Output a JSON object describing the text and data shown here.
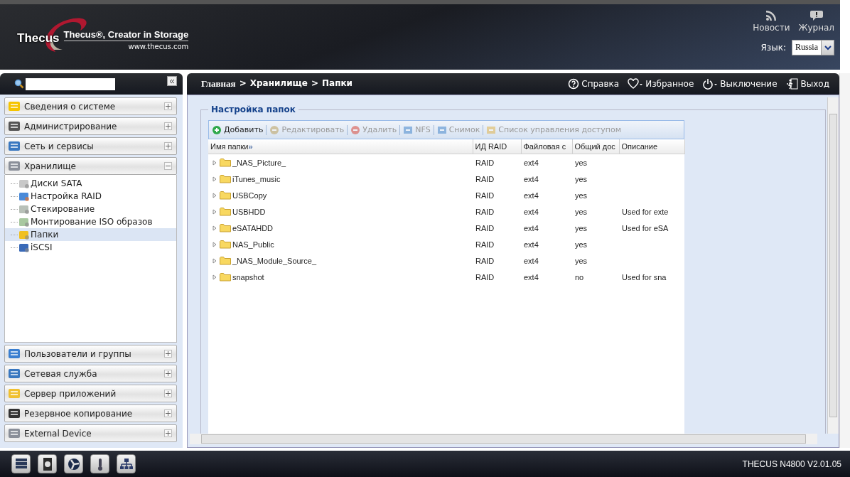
{
  "header": {
    "logo": "Thecus",
    "slogan": "Thecus®, Creator in Storage",
    "url": "www.thecus.com",
    "links": [
      {
        "label": "Новости"
      },
      {
        "label": "Журнал"
      }
    ],
    "language": {
      "label": "Язык:",
      "value": "Russia"
    }
  },
  "sidebar": {
    "sections": [
      {
        "label": "Сведения о системе",
        "expanded": false
      },
      {
        "label": "Администрирование",
        "expanded": false
      },
      {
        "label": "Сеть и сервисы",
        "expanded": false
      },
      {
        "label": "Хранилище",
        "expanded": true,
        "children": [
          {
            "label": "Диски SATA",
            "selected": false
          },
          {
            "label": "Настройка RAID",
            "selected": false
          },
          {
            "label": "Стекирование",
            "selected": false
          },
          {
            "label": "Монтирование ISO образов",
            "selected": false
          },
          {
            "label": "Папки",
            "selected": true
          },
          {
            "label": "iSCSI",
            "selected": false
          }
        ]
      },
      {
        "label": "Пользователи и группы",
        "expanded": false
      },
      {
        "label": "Сетевая служба",
        "expanded": false
      },
      {
        "label": "Сервер приложений",
        "expanded": false
      },
      {
        "label": "Резервное копирование",
        "expanded": false
      },
      {
        "label": "External Device",
        "expanded": false
      }
    ]
  },
  "breadcrumb": {
    "items": [
      "Главная",
      "Хранилище",
      "Папки"
    ],
    "separator": ">"
  },
  "nav": [
    {
      "label": "Справка",
      "kind": "help"
    },
    {
      "label": "Избранное",
      "kind": "favorite"
    },
    {
      "label": "Выключение",
      "kind": "power"
    },
    {
      "label": "Выход",
      "kind": "exit"
    }
  ],
  "panel": {
    "title": "Настройка папок",
    "toolbar": [
      {
        "label": "Добавить",
        "disabled": false
      },
      {
        "label": "Редактировать",
        "disabled": true
      },
      {
        "label": "Удалить",
        "disabled": true
      },
      {
        "label": "NFS",
        "disabled": true
      },
      {
        "label": "Снимок",
        "disabled": true
      },
      {
        "label": "Список управления доступом",
        "disabled": true
      }
    ],
    "columns": [
      "Имя папки",
      "ИД RAID",
      "Файловая с",
      "Общий дос",
      "Описание"
    ],
    "sort_mark": "»",
    "rows": [
      {
        "name": "_NAS_Picture_",
        "raid": "RAID",
        "fs": "ext4",
        "shared": "yes"
      },
      {
        "name": "iTunes_music",
        "raid": "RAID",
        "fs": "ext4",
        "shared": "yes"
      },
      {
        "name": "USBCopy",
        "raid": "RAID",
        "fs": "ext4",
        "shared": "yes"
      },
      {
        "name": "USBHDD",
        "raid": "RAID",
        "fs": "ext4",
        "shared": "yes",
        "description": "Used for exte"
      },
      {
        "name": "eSATAHDD",
        "raid": "RAID",
        "fs": "ext4",
        "shared": "yes",
        "description": "Used for eSA"
      },
      {
        "name": "NAS_Public",
        "raid": "RAID",
        "fs": "ext4",
        "shared": "yes"
      },
      {
        "name": "_NAS_Module_Source_",
        "raid": "RAID",
        "fs": "ext4",
        "shared": "yes"
      },
      {
        "name": "snapshot",
        "raid": "RAID",
        "fs": "ext4",
        "shared": "no",
        "description": "Used for sna"
      }
    ]
  },
  "status_bar": {
    "version": "THECUS N4800 V2.01.05"
  }
}
